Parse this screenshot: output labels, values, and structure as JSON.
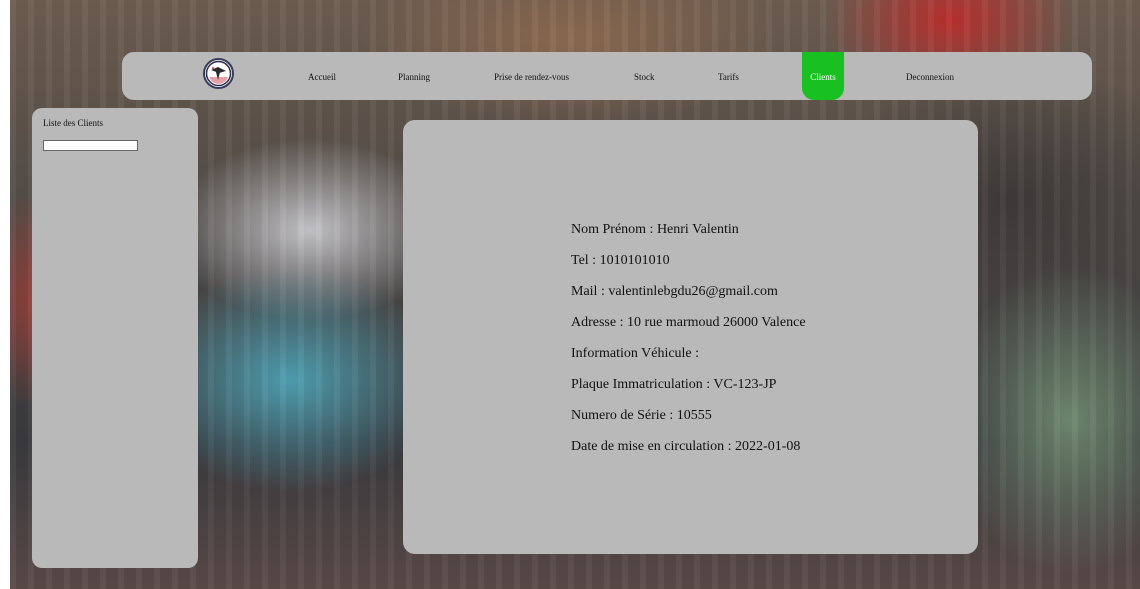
{
  "nav": {
    "items": [
      {
        "label": "Accueil"
      },
      {
        "label": "Planning"
      },
      {
        "label": "Prise de rendez-vous"
      },
      {
        "label": "Stock"
      },
      {
        "label": "Tarifs"
      },
      {
        "label": "Clients",
        "active": true
      },
      {
        "label": "Deconnexion"
      }
    ],
    "active_color": "#18c022",
    "logo_icon": "garage-logo-icon"
  },
  "sidebar": {
    "title": "Liste des Clients",
    "search_value": ""
  },
  "client": {
    "name": "Nom Prénom : Henri Valentin",
    "tel": "Tel : 1010101010",
    "mail": "Mail : valentinlebgdu26@gmail.com",
    "address": "Adresse : 10 rue marmoud 26000 Valence",
    "vehicle_header": "Information Véhicule :",
    "plate": "Plaque Immatriculation : VC-123-JP",
    "serial": "Numero de Série : 10555",
    "circulation_date": "Date de mise en circulation : 2022-01-08"
  },
  "colors": {
    "panel": "#b9b9b9"
  }
}
